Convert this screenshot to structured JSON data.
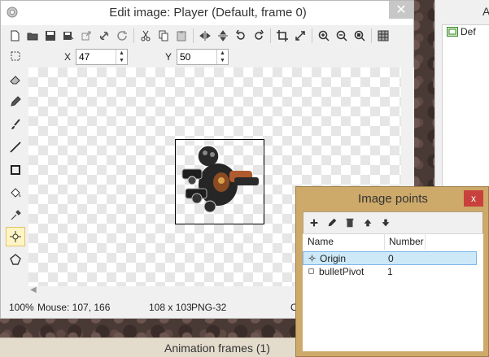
{
  "background_panel": {
    "title_fragment": "A",
    "list_item": "Def"
  },
  "animation_bar": {
    "label": "Animation frames (1)"
  },
  "edit_window": {
    "title": "Edit image: Player (Default, frame 0)",
    "close_glyph": "✕",
    "toolbar": [
      "new-file-icon",
      "open-folder-icon",
      "save-icon",
      "save-as-icon",
      "export-icon",
      "link-icon",
      "refresh-icon",
      "sep",
      "cut-icon",
      "copy-icon",
      "paste-icon",
      "sep",
      "flip-horizontal-icon",
      "flip-vertical-icon",
      "rotate-ccw-icon",
      "rotate-cw-icon",
      "sep",
      "crop-icon",
      "resize-icon",
      "sep",
      "zoom-in-icon",
      "zoom-out-icon",
      "zoom-fit-icon",
      "sep",
      "grid-icon"
    ],
    "x_label": "X",
    "x_value": "47",
    "y_label": "Y",
    "y_value": "50",
    "left_tools": [
      "rectangle-select-icon",
      "eraser-icon",
      "pencil-icon",
      "brush-icon",
      "line-icon",
      "rectangle-icon",
      "fill-bucket-icon",
      "color-picker-icon",
      "image-points-icon",
      "polygon-collision-icon"
    ],
    "active_tool": "image-points-icon",
    "status": {
      "zoom": "100%",
      "mouse": "Mouse: 107, 166",
      "size": "108 x 103",
      "format": "PNG-32",
      "truncated": "O"
    }
  },
  "image_points_window": {
    "title": "Image points",
    "close_glyph": "x",
    "toolbar": [
      "add-icon",
      "edit-icon",
      "delete-icon",
      "move-up-icon",
      "move-down-icon"
    ],
    "columns": [
      "Name",
      "Number"
    ],
    "rows": [
      {
        "name": "Origin",
        "number": "0",
        "selected": true,
        "icon": "origin-crosshair-icon"
      },
      {
        "name": "bulletPivot",
        "number": "1",
        "selected": false,
        "icon": "point-square-icon"
      }
    ]
  },
  "colors": {
    "window_bg": "#f0f0f0",
    "image_points_frame": "#cda96a",
    "close_red": "#c9413c",
    "active_tool_bg": "#fff5c4",
    "selection_bg": "#cde8f7"
  }
}
